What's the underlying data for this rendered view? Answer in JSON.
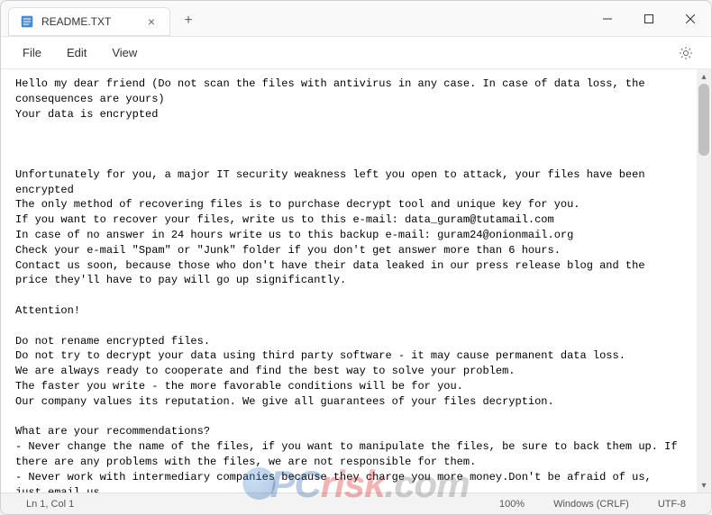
{
  "titlebar": {
    "tab_title": "README.TXT",
    "new_tab": "+",
    "close_tab": "×"
  },
  "menubar": {
    "file": "File",
    "edit": "Edit",
    "view": "View"
  },
  "content": {
    "text": "Hello my dear friend (Do not scan the files with antivirus in any case. In case of data loss, the consequences are yours)\nYour data is encrypted\n\n\n\nUnfortunately for you, a major IT security weakness left you open to attack, your files have been encrypted\nThe only method of recovering files is to purchase decrypt tool and unique key for you.\nIf you want to recover your files, write us to this e-mail: data_guram@tutamail.com\nIn case of no answer in 24 hours write us to this backup e-mail: guram24@onionmail.org\nCheck your e-mail \"Spam\" or \"Junk\" folder if you don't get answer more than 6 hours.\nContact us soon, because those who don't have their data leaked in our press release blog and the price they'll have to pay will go up significantly.\n\nAttention!\n\nDo not rename encrypted files.\nDo not try to decrypt your data using third party software - it may cause permanent data loss.\nWe are always ready to cooperate and find the best way to solve your problem.\nThe faster you write - the more favorable conditions will be for you.\nOur company values its reputation. We give all guarantees of your files decryption.\n\nWhat are your recommendations?\n- Never change the name of the files, if you want to manipulate the files, be sure to back them up. If there are any problems with the files, we are not responsible for them.\n- Never work with intermediary companies because they charge you more money.Don't be afraid of us, just email us.\n\n\nSensitive data on your system was DOWNLOADED.\nIf you DON'T WANT your sensitive data to be PUBLISHED you have to act quickly.\n\nData includes:\n- Employees personal data, CVs, DL, SSN.\n- Complete network map including credentials for local and remote services."
  },
  "statusbar": {
    "position": "Ln 1, Col 1",
    "zoom": "100%",
    "line_ending": "Windows (CRLF)",
    "encoding": "UTF-8"
  },
  "watermark": {
    "pc": "PC",
    "risk": "risk",
    "com": ".com"
  }
}
